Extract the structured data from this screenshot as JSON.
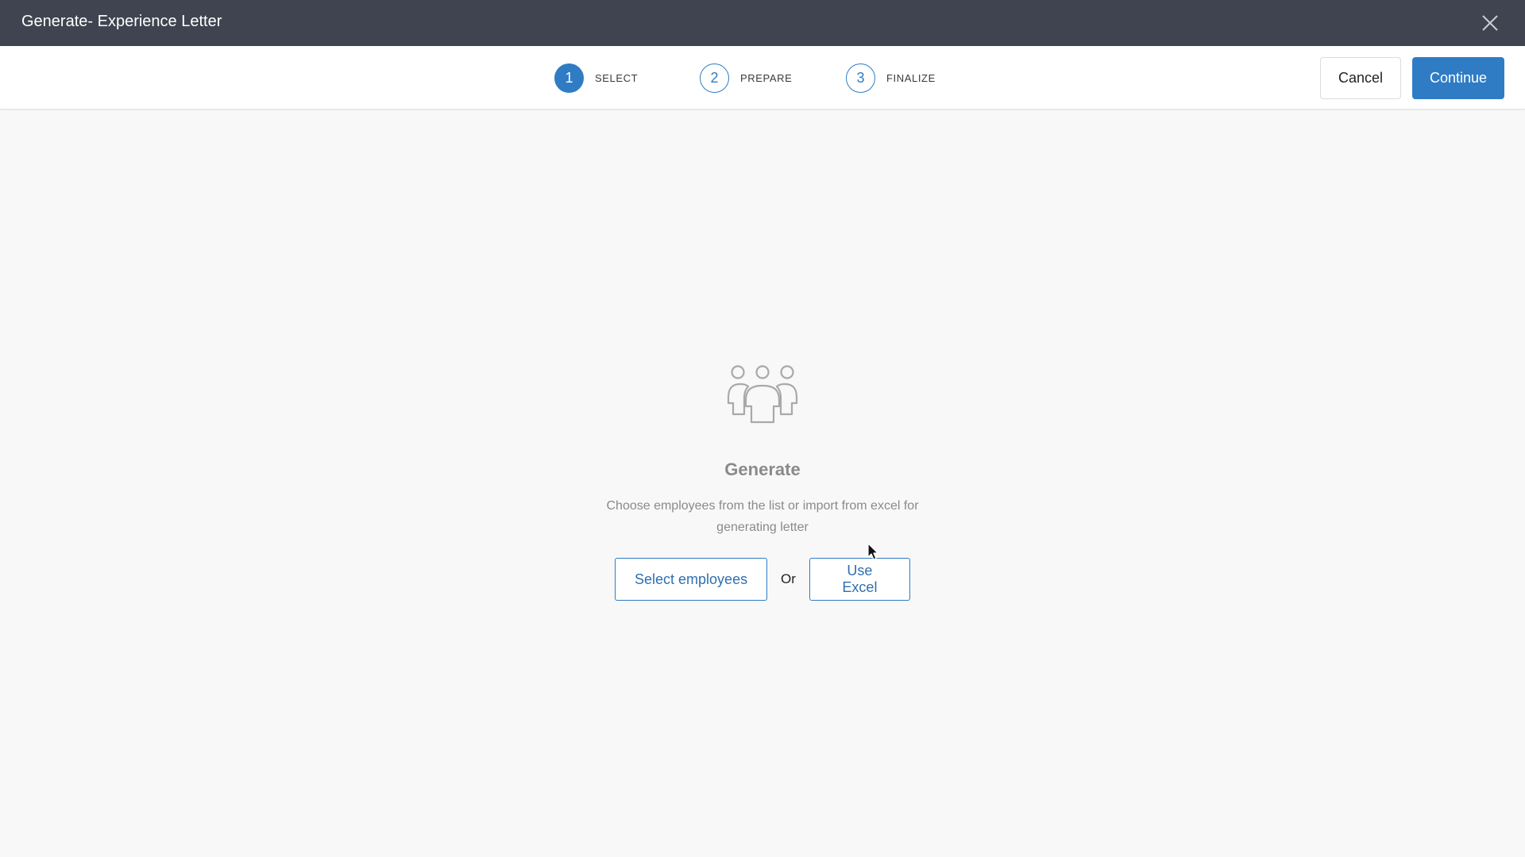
{
  "window": {
    "title": "Generate- Experience Letter",
    "close_icon": "close-icon"
  },
  "stepper": {
    "steps": [
      {
        "number": "1",
        "label": "SELECT",
        "active": true
      },
      {
        "number": "2",
        "label": "PREPARE",
        "active": false
      },
      {
        "number": "3",
        "label": "FINALIZE",
        "active": false
      }
    ]
  },
  "toolbar": {
    "cancel_label": "Cancel",
    "continue_label": "Continue"
  },
  "empty_state": {
    "icon": "people-group-icon",
    "title": "Generate",
    "description": "Choose employees from the list or import from excel for generating letter",
    "select_employees_label": "Select employees",
    "or_label": "Or",
    "use_excel_label": "Use Excel"
  },
  "colors": {
    "titlebar_bg": "#3f4450",
    "accent": "#2f7cc4",
    "page_bg": "#f8f8f8",
    "muted_text": "#8a8a8a"
  }
}
